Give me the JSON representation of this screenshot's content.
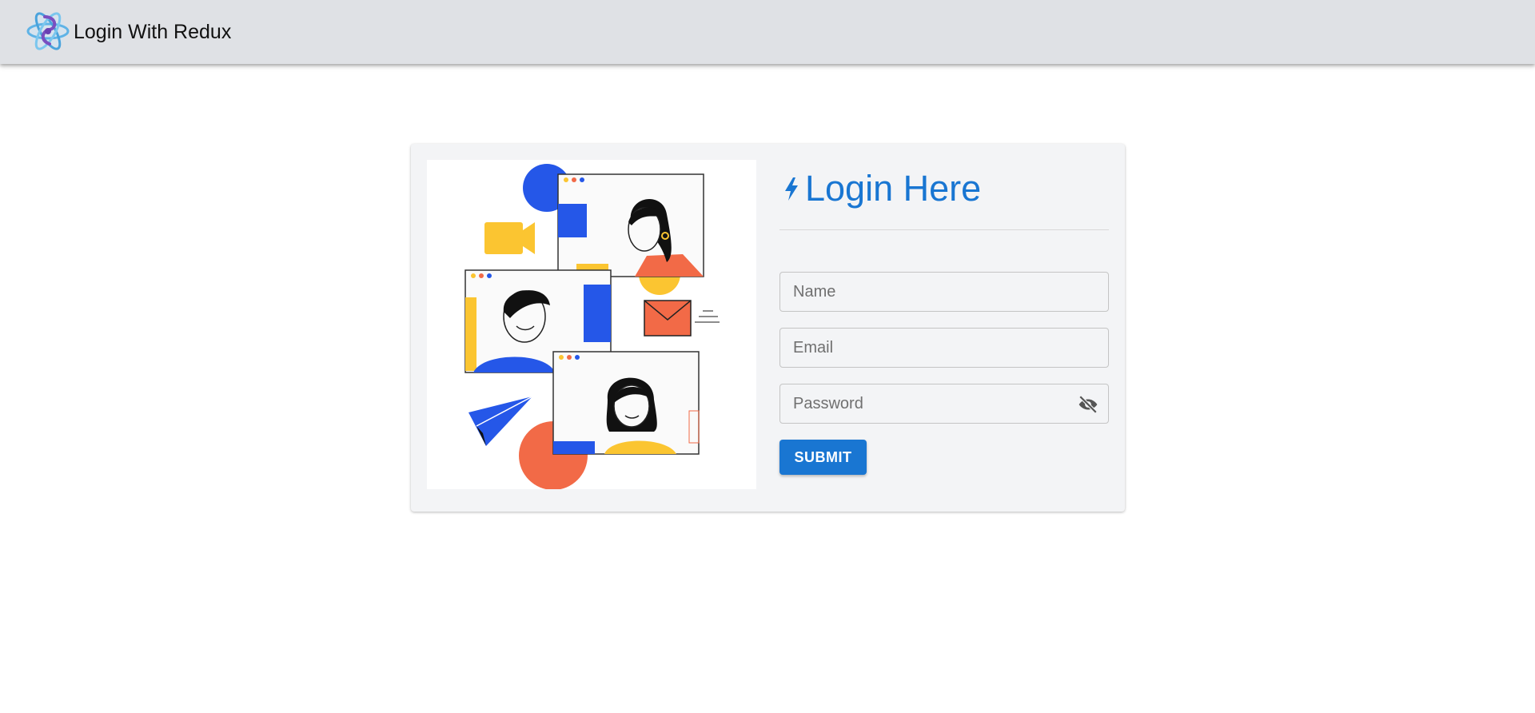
{
  "appbar": {
    "title": "Login With Redux",
    "logo_icon": "react-atom-logo-icon"
  },
  "login": {
    "heading": "Login Here",
    "heading_icon": "bolt-icon",
    "name_placeholder": "Name",
    "email_placeholder": "Email",
    "password_placeholder": "Password",
    "password_toggle_icon": "eye-off-icon",
    "submit_label": "SUBMIT"
  },
  "colors": {
    "primary": "#1976d2",
    "appbar_bg": "#dfe1e5",
    "card_bg": "#f3f4f6"
  }
}
